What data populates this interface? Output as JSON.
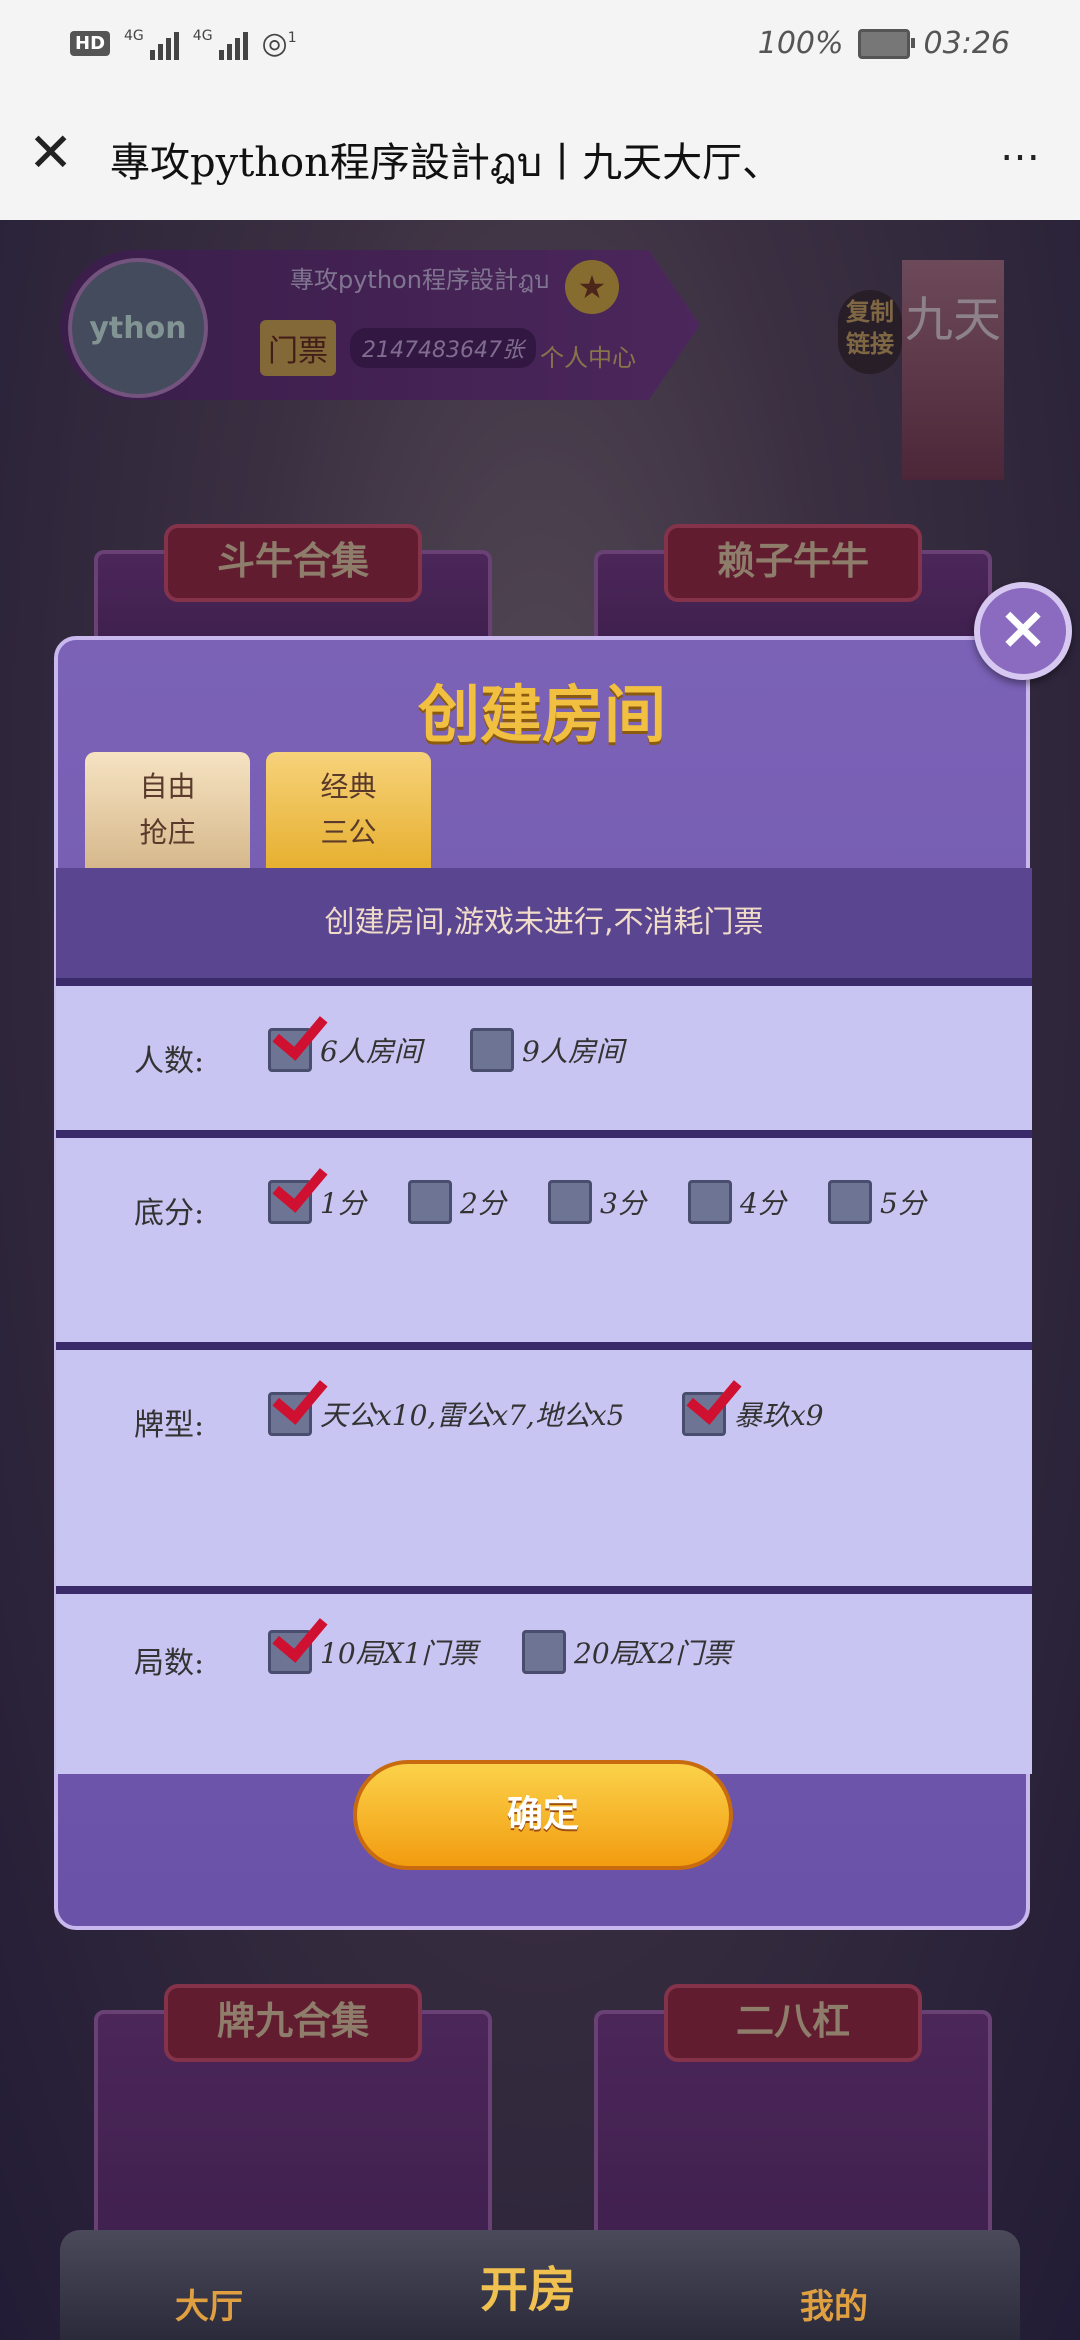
{
  "status_bar": {
    "hd": "HD",
    "net1": "4G",
    "net2": "4G",
    "hotspot_badge": "1",
    "battery": "100%",
    "time": "03:26"
  },
  "title_bar": {
    "close_icon": "close-icon",
    "title": "專攻python程序設計ฎบ丨九天大厅、",
    "more": "…"
  },
  "game": {
    "player_name": "專攻python程序設計ฎบ",
    "avatar_text": "ython",
    "ticket_label": "门票",
    "ticket_count": "2147483647张",
    "personal_center": "个人中心",
    "copy_link": "复制链接",
    "banner": "九天",
    "cards": [
      "斗牛合集",
      "赖子牛牛",
      "牌九合集",
      "二八杠"
    ],
    "nav": {
      "home": "大厅",
      "open_room": "开房",
      "mine": "我的"
    }
  },
  "dialog": {
    "title": "创建房间",
    "tabs": [
      {
        "line1": "自由",
        "line2": "抢庄"
      },
      {
        "line1": "经典",
        "line2": "三公"
      }
    ],
    "notice": "创建房间,游戏未进行,不消耗门票",
    "rows": {
      "players": {
        "label": "人数:",
        "options": [
          {
            "text": "6人房间",
            "checked": true
          },
          {
            "text": "9人房间",
            "checked": false
          }
        ]
      },
      "base_score": {
        "label": "底分:",
        "options": [
          {
            "text": "1分",
            "checked": true
          },
          {
            "text": "2分",
            "checked": false
          },
          {
            "text": "3分",
            "checked": false
          },
          {
            "text": "4分",
            "checked": false
          },
          {
            "text": "5分",
            "checked": false
          }
        ]
      },
      "card_type": {
        "label": "牌型:",
        "options": [
          {
            "text": "天公x10,雷公x7,地公x5",
            "checked": true
          },
          {
            "text": "暴玖x9",
            "checked": true
          }
        ]
      },
      "rounds": {
        "label": "局数:",
        "options": [
          {
            "text": "10局X1门票",
            "checked": true
          },
          {
            "text": "20局X2门票",
            "checked": false
          }
        ]
      }
    },
    "confirm": "确定",
    "close": "×"
  }
}
